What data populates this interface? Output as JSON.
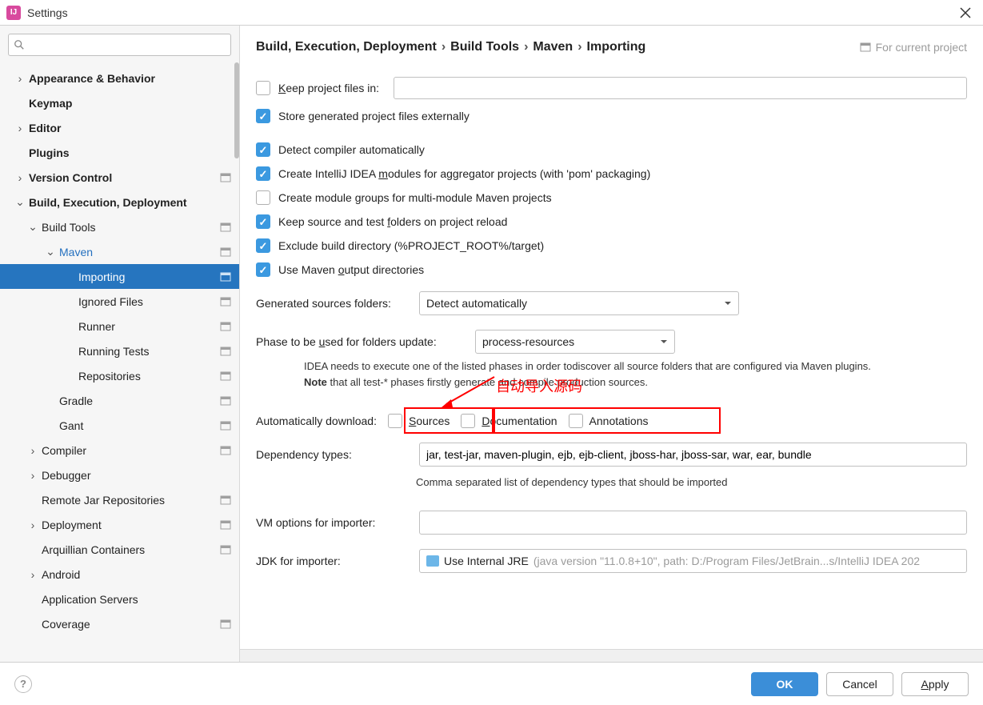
{
  "title": "Settings",
  "search_placeholder": "",
  "tree": {
    "appearance": "Appearance & Behavior",
    "keymap": "Keymap",
    "editor": "Editor",
    "plugins": "Plugins",
    "vcs": "Version Control",
    "bed": "Build, Execution, Deployment",
    "build_tools": "Build Tools",
    "maven": "Maven",
    "importing": "Importing",
    "ignored": "Ignored Files",
    "runner": "Runner",
    "running_tests": "Running Tests",
    "repositories": "Repositories",
    "gradle": "Gradle",
    "gant": "Gant",
    "compiler": "Compiler",
    "debugger": "Debugger",
    "remote_jar": "Remote Jar Repositories",
    "deployment": "Deployment",
    "arquillian": "Arquillian Containers",
    "android": "Android",
    "app_servers": "Application Servers",
    "coverage": "Coverage"
  },
  "breadcrumb": {
    "bed": "Build, Execution, Deployment",
    "build_tools": "Build Tools",
    "maven": "Maven",
    "importing": "Importing",
    "for_project": "For current project"
  },
  "options": {
    "keep_project_files": "Keep project files in:",
    "store_externally": "Store generated project files externally",
    "detect_compiler": "Detect compiler automatically",
    "create_modules": "Create IntelliJ IDEA modules for aggregator projects (with 'pom' packaging)",
    "create_groups": "Create module groups for multi-module Maven projects",
    "keep_folders": "Keep source and test folders on project reload",
    "exclude_build": "Exclude build directory (%PROJECT_ROOT%/target)",
    "use_output": "Use Maven output directories",
    "gen_sources_label": "Generated sources folders:",
    "gen_sources_value": "Detect automatically",
    "phase_label": "Phase to be used for folders update:",
    "phase_value": "process-resources",
    "note_line1": "IDEA needs to execute one of the listed phases in order todiscover all source folders that are configured via Maven plugins.",
    "note_bold": "Note",
    "note_line2": " that all test-* phases firstly generate and compile production sources.",
    "auto_download_label": "Automatically download:",
    "sources": "Sources",
    "documentation": "Documentation",
    "annotations": "Annotations",
    "dep_types_label": "Dependency types:",
    "dep_types_value": "jar, test-jar, maven-plugin, ejb, ejb-client, jboss-har, jboss-sar, war, ear, bundle",
    "dep_types_hint": "Comma separated list of dependency types that should be imported",
    "vm_label": "VM options for importer:",
    "vm_value": "",
    "jdk_label": "JDK for importer:",
    "jdk_value_main": "Use Internal JRE",
    "jdk_value_gray": " (java version \"11.0.8+10\", path: D:/Program Files/JetBrain...s/IntelliJ IDEA 202"
  },
  "annotation": "自动导入源码",
  "buttons": {
    "ok": "OK",
    "cancel": "Cancel",
    "apply": "Apply"
  }
}
